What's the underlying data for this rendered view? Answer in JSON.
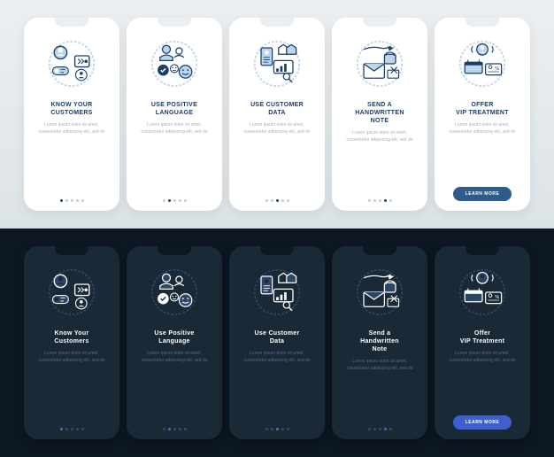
{
  "placeholder_body": "Lorem ipsum dolor sit amet, consectetur adipiscing elit, sed do",
  "cta_label": "LEARN MORE",
  "screens": [
    {
      "title": "KNOW YOUR\nCUSTOMERS"
    },
    {
      "title": "USE POSITIVE\nLANGUAGE"
    },
    {
      "title": "USE CUSTOMER\nDATA"
    },
    {
      "title": "SEND A\nHANDWRITTEN\nNOTE"
    },
    {
      "title": "OFFER\nVIP TREATMENT"
    }
  ],
  "dark_screens": [
    {
      "title": "Know Your\nCustomers"
    },
    {
      "title": "Use Positive\nLanguage"
    },
    {
      "title": "Use Customer\nData"
    },
    {
      "title": "Send a\nHandwritten\nNote"
    },
    {
      "title": "Offer\nVIP Treatment"
    }
  ],
  "colors": {
    "light_stroke": "#1a3d6b",
    "light_fill": "#bcd6ea",
    "dark_stroke": "#ffffff",
    "dark_fill": "#2a4766"
  }
}
